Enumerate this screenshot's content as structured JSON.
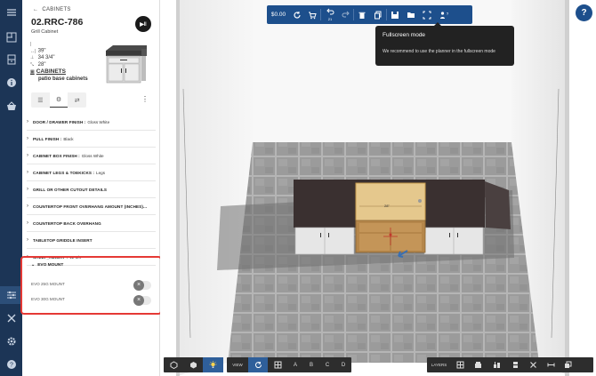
{
  "breadcrumb": {
    "label": "CABINETS"
  },
  "product": {
    "code": "02.RRC-786",
    "subtitle": "Grill Cabinet",
    "width": "39\"",
    "height": "34 3/4\"",
    "depth": "28\"",
    "category": "CABINETS",
    "subcategory": "patio base cabinets"
  },
  "sections": [
    {
      "label": "DOOR / DRAWER FINISH :",
      "value": "Gloss White"
    },
    {
      "label": "PULL FINISH :",
      "value": "Black"
    },
    {
      "label": "CABINET BOX FINISH :",
      "value": "Gloss White"
    },
    {
      "label": "CABINET LEGS & TOEKICKS :",
      "value": "Legs"
    },
    {
      "label": "GRILL OR OTHER CUTOUT DETAILS",
      "value": ""
    },
    {
      "label": "COUNTERTOP FRONT OVERHANG AMOUNT (INCHES)...",
      "value": ""
    },
    {
      "label": "COUNTERTOP BACK OVERHANG",
      "value": ""
    },
    {
      "label": "TABLETOP GRIDDLE INSERT",
      "value": ""
    },
    {
      "label": "SHELF_HEIGHT :",
      "value": "12 3/4\""
    }
  ],
  "evo": {
    "title": "EVO MOUNT",
    "options": [
      {
        "label": "EVO 25G MOUNT",
        "enabled": false
      },
      {
        "label": "EVO 30G MOUNT",
        "enabled": false
      }
    ]
  },
  "topbar": {
    "price": "$0.00",
    "undo_count": "21"
  },
  "tooltip": {
    "title": "Fullscreen mode",
    "text": "We recommend to use the planner in the fullscreen mode"
  },
  "help": {
    "label": "?"
  },
  "bottombar": {
    "view_label": "VIEW",
    "wall_labels": [
      "A",
      "B",
      "C",
      "D"
    ],
    "layers_label": "LAYERS"
  },
  "scene": {
    "dimension_label": "28\""
  },
  "colors": {
    "rail": "#1c3556",
    "toolbar": "#1d4f8c",
    "highlight": "#e53935",
    "floor": "#9a9a9a",
    "countertop": "#3a3030",
    "wood": "#e5c88d"
  }
}
